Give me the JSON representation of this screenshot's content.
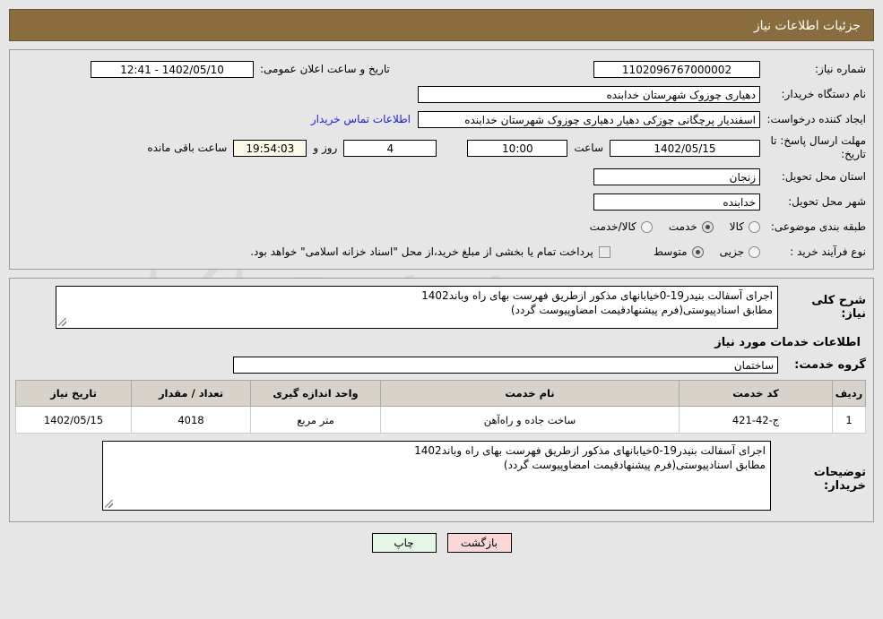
{
  "header": {
    "title": "جزئیات اطلاعات نیاز"
  },
  "summary": {
    "need_number_label": "شماره نیاز:",
    "need_number_value": "1102096767000002",
    "announce_datetime_label": "تاریخ و ساعت اعلان عمومی:",
    "announce_datetime_value": "1402/05/10 - 12:41",
    "buyer_org_label": "نام دستگاه خریدار:",
    "buyer_org_value": "دهیاری چوزوک شهرستان خدابنده",
    "requester_label": "ایجاد کننده درخواست:",
    "requester_value": "اسفندیار پرچگانی چوزکی دهیار دهیاری چوزوک شهرستان خدابنده",
    "contact_link": "اطلاعات تماس خریدار",
    "deadline_label": "مهلت ارسال پاسخ: تا تاریخ:",
    "deadline_date": "1402/05/15",
    "deadline_time_label": "ساعت",
    "deadline_time": "10:00",
    "remaining_days": "4",
    "remaining_days_label": "روز و",
    "remaining_clock": "19:54:03",
    "remaining_clock_label": "ساعت باقی مانده",
    "province_label": "استان محل تحویل:",
    "province_value": "زنجان",
    "city_label": "شهر محل تحویل:",
    "city_value": "خدابنده",
    "category_label": "طبقه بندی موضوعی:",
    "category_options": [
      {
        "label": "کالا",
        "selected": false
      },
      {
        "label": "خدمت",
        "selected": true
      },
      {
        "label": "کالا/خدمت",
        "selected": false
      }
    ],
    "process_label": "نوع فرآیند خرید :",
    "process_options": [
      {
        "label": "جزیی",
        "selected": false
      },
      {
        "label": "متوسط",
        "selected": true
      }
    ],
    "treasury_checkbox_label": "پرداخت تمام یا بخشی از مبلغ خرید،از محل \"اسناد خزانه اسلامی\" خواهد بود.",
    "treasury_checked": false
  },
  "description": {
    "label": "شرح کلی نیاز:",
    "value": "اجرای آسفالت بنیدر19-0خیابانهای مذکور ازطریق فهرست بهای راه وباند1402\nمطابق اسنادپیوستی(فرم پیشنهادقیمت امضاوپیوست گردد)"
  },
  "services": {
    "section_title": "اطلاعات خدمات مورد نیاز",
    "group_label": "گروه خدمت:",
    "group_value": "ساختمان",
    "columns": [
      "ردیف",
      "کد خدمت",
      "نام خدمت",
      "واحد اندازه گیری",
      "تعداد / مقدار",
      "تاریخ نیاز"
    ],
    "rows": [
      {
        "radif": "1",
        "code": "ج-42-421",
        "name": "ساخت جاده و راه‌آهن",
        "unit": "متر مربع",
        "qty": "4018",
        "date": "1402/05/15"
      }
    ]
  },
  "notes": {
    "label": "توضیحات خریدار:",
    "value": "اجرای آسفالت بنیدر19-0خیابانهای مذکور ازطریق فهرست بهای راه وباند1402\nمطابق اسنادپیوستی(فرم پیشنهادقیمت امضاوپیوست گردد)"
  },
  "footer": {
    "print_label": "چاپ",
    "back_label": "بازگشت"
  },
  "watermark": {
    "text": "anaTender.ir"
  },
  "colors": {
    "titlebar": "#8a6d3f",
    "page_bg": "#e6e6e6",
    "link": "#1a1aee",
    "countdown_bg": "#fbfbe8",
    "table_header_bg": "#d7d3cb",
    "print_btn_bg": "#e6f6e6",
    "back_btn_bg": "#fbd7d7"
  }
}
